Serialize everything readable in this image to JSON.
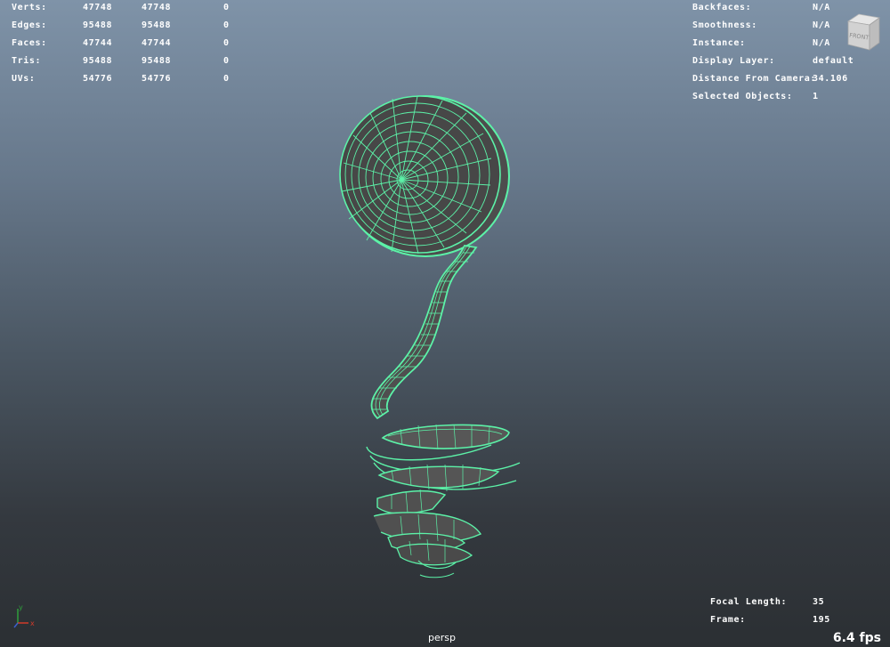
{
  "viewport": {
    "camera": "persp",
    "fps": "6.4 fps"
  },
  "stats": [
    {
      "label": "Verts:",
      "total": "47748",
      "selected": "47748",
      "component": "0"
    },
    {
      "label": "Edges:",
      "total": "95488",
      "selected": "95488",
      "component": "0"
    },
    {
      "label": "Faces:",
      "total": "47744",
      "selected": "47744",
      "component": "0"
    },
    {
      "label": "Tris:",
      "total": "95488",
      "selected": "95488",
      "component": "0"
    },
    {
      "label": "UVs:",
      "total": "54776",
      "selected": "54776",
      "component": "0"
    }
  ],
  "info": [
    {
      "label": "Backfaces:",
      "value": "N/A"
    },
    {
      "label": "Smoothness:",
      "value": "N/A"
    },
    {
      "label": "Instance:",
      "value": "N/A"
    },
    {
      "label": "Display Layer:",
      "value": "default"
    },
    {
      "label": "Distance From Camera:",
      "value": "34.106"
    },
    {
      "label": "Selected Objects:",
      "value": "1"
    }
  ],
  "camera_info": [
    {
      "label": "Focal Length:",
      "value": "35"
    },
    {
      "label": "Frame:",
      "value": "195"
    }
  ],
  "view_cube": {
    "face_label": "FRONT"
  },
  "axis": {
    "y_label": "y",
    "x_label": "x"
  },
  "colors": {
    "wireframe": "#5cf2a8",
    "surface": "#4d4d4d",
    "bg_top": "#7f93a8",
    "bg_bottom": "#2b2f33",
    "axis_y": "#2f9e3c",
    "axis_x": "#d03a2a",
    "axis_z": "#3a5fd0"
  }
}
